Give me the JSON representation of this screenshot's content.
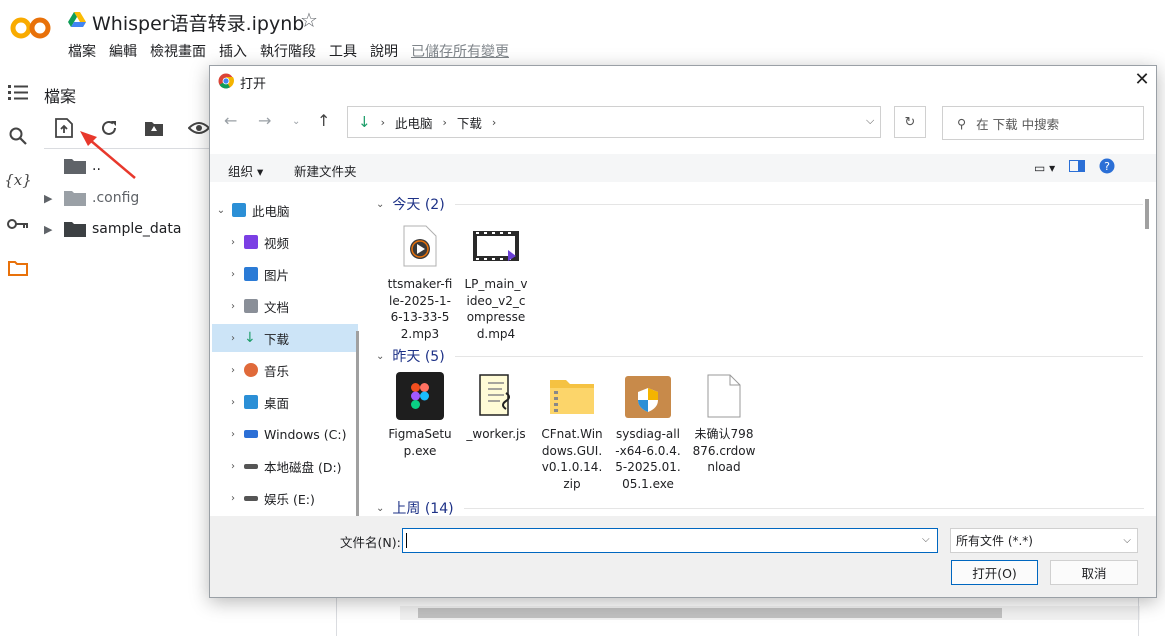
{
  "colab": {
    "notebook_title": "Whisper语音转录.ipynb",
    "menu": [
      "檔案",
      "編輯",
      "檢視畫面",
      "插入",
      "執行階段",
      "工具",
      "說明"
    ],
    "saved_status": "已儲存所有變更",
    "files_panel_title": "檔案",
    "file_tree": [
      {
        "name": "..",
        "expandable": false
      },
      {
        "name": ".config",
        "expandable": true
      },
      {
        "name": "sample_data",
        "expandable": true
      }
    ]
  },
  "dialog": {
    "title": "打开",
    "address": [
      "此电脑",
      "下载"
    ],
    "search_placeholder": "在 下载 中搜索",
    "organize_label": "组织",
    "new_folder_label": "新建文件夹",
    "nav_items": [
      {
        "label": "此电脑",
        "icon": "pc-icon",
        "color": "#2b8fd6"
      },
      {
        "label": "视频",
        "icon": "video-icon",
        "color": "#7b3fe4"
      },
      {
        "label": "图片",
        "icon": "pictures-icon",
        "color": "#2b7bd6"
      },
      {
        "label": "文档",
        "icon": "documents-icon",
        "color": "#8a8f98"
      },
      {
        "label": "下载",
        "icon": "downloads-icon",
        "color": "#1e9e6a"
      },
      {
        "label": "音乐",
        "icon": "music-icon",
        "color": "#e06a3a"
      },
      {
        "label": "桌面",
        "icon": "desktop-icon",
        "color": "#2b8fd6"
      },
      {
        "label": "Windows (C:)",
        "icon": "drive-icon",
        "color": "#2b6fd6"
      },
      {
        "label": "本地磁盘 (D:)",
        "icon": "drive-icon",
        "color": "#555555"
      },
      {
        "label": "娱乐 (E:)",
        "icon": "drive-icon",
        "color": "#555555"
      }
    ],
    "groups": [
      {
        "label": "今天 (2)"
      },
      {
        "label": "昨天 (5)"
      },
      {
        "label": "上周 (14)"
      }
    ],
    "files_today": [
      {
        "name": "ttsmaker-file-2025-1-6-13-33-52.mp3",
        "icon": "audio-file-icon"
      },
      {
        "name": "LP_main_video_v2_compressed.mp4",
        "icon": "video-file-icon"
      }
    ],
    "files_yesterday": [
      {
        "name": "FigmaSetup.exe",
        "icon": "figma-icon"
      },
      {
        "name": "_worker.js",
        "icon": "js-file-icon"
      },
      {
        "name": "CFnat.Windows.GUI.v0.1.0.14.zip",
        "icon": "zip-folder-icon"
      },
      {
        "name": "sysdiag-all-x64-6.0.4.5-2025.01.05.1.exe",
        "icon": "installer-icon"
      },
      {
        "name": "未确认798876.crdownload",
        "icon": "blank-file-icon"
      }
    ],
    "filename_label": "文件名(N):",
    "filename_value": "",
    "filetype_value": "所有文件 (*.*)",
    "open_label": "打开(O)",
    "cancel_label": "取消"
  },
  "colors": {
    "accent": "#0067c0",
    "group_heading": "#1e3287",
    "annotation_arrow": "#e8382c"
  }
}
